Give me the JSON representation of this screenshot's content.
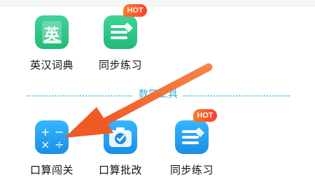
{
  "top_row": {
    "items": [
      {
        "label": "英汉词典",
        "icon_text": "英",
        "icon": "book-icon",
        "color": "#22b978"
      },
      {
        "label": "同步练习",
        "icon": "notebook-pen-icon",
        "color": "#22b978",
        "badge": "HOT"
      }
    ]
  },
  "section": {
    "title": "数学工具"
  },
  "math_tools": {
    "items": [
      {
        "label": "口算闯关",
        "icon": "calculator-icon",
        "color": "#1a8fe6"
      },
      {
        "label": "口算批改",
        "icon": "camera-check-icon",
        "color": "#1a8fe6"
      },
      {
        "label": "同步练习",
        "icon": "notebook-pen-icon",
        "color": "#1a8fe6",
        "badge": "HOT"
      }
    ]
  },
  "annotation": {
    "arrow_color": "#f26a2e",
    "icon": "pointer-arrow-icon"
  }
}
